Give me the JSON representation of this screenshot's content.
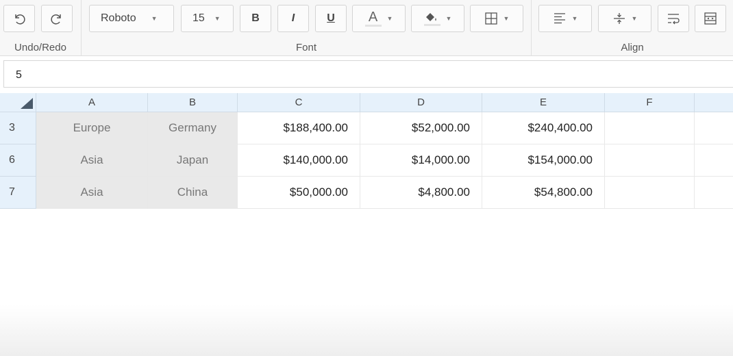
{
  "toolbar": {
    "undo_redo": {
      "label": "Undo/Redo"
    },
    "font": {
      "label": "Font",
      "family": "Roboto",
      "size": "15",
      "bold": "B",
      "italic": "I",
      "underline": "U",
      "text_color_glyph": "A"
    },
    "align": {
      "label": "Align"
    }
  },
  "formula_bar": {
    "value": "5"
  },
  "grid": {
    "columns": [
      "A",
      "B",
      "C",
      "D",
      "E",
      "F"
    ],
    "rows": [
      {
        "num": "3",
        "cells": [
          "Europe",
          "Germany",
          "$188,400.00",
          "$52,000.00",
          "$240,400.00",
          ""
        ]
      },
      {
        "num": "6",
        "cells": [
          "Asia",
          "Japan",
          "$140,000.00",
          "$14,000.00",
          "$154,000.00",
          ""
        ]
      },
      {
        "num": "7",
        "cells": [
          "Asia",
          "China",
          "$50,000.00",
          "$4,800.00",
          "$54,800.00",
          ""
        ]
      }
    ]
  }
}
